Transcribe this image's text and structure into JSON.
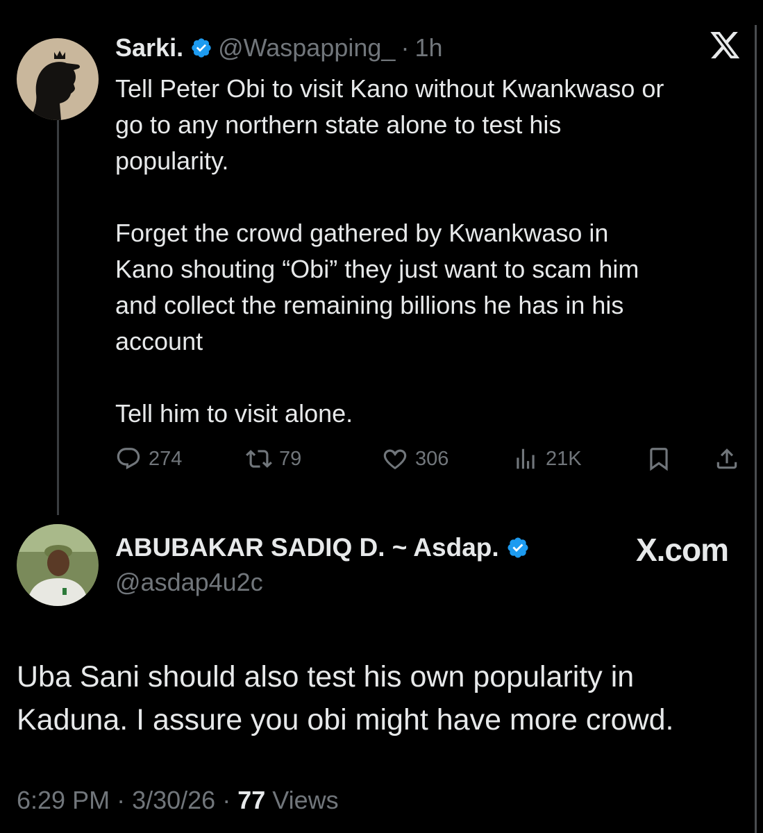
{
  "original_tweet": {
    "author_name": "Sarki.",
    "handle": "@Waspapping_",
    "separator": "·",
    "time_ago": "1h",
    "platform_logo": "X",
    "paragraphs": [
      "Tell Peter Obi to visit Kano without Kwankwaso or\ngo to any northern state alone to test his\npopularity.",
      "Forget the crowd gathered by Kwankwaso in\nKano shouting “Obi” they just want to scam him\nand collect the remaining billions he has in his\naccount",
      "Tell him to visit alone."
    ],
    "actions": {
      "replies": "274",
      "reposts": "79",
      "likes": "306",
      "views": "21K"
    }
  },
  "reply_tweet": {
    "author_name": "ABUBAKAR SADIQ D. ~ Asdap.",
    "handle": "@asdap4u2c",
    "watermark": "X.com",
    "text": "Uba Sani should also test his own popularity in\nKaduna. I assure you obi might have more crowd.",
    "footer": {
      "time": "6:29 PM",
      "sep1": " · ",
      "date": "3/30/26",
      "sep2": " · ",
      "views_count": "77",
      "views_label": "Views"
    }
  },
  "colors": {
    "background": "#000000",
    "text": "#e7e9ea",
    "muted": "#71767b",
    "verified": "#1d9bf0"
  },
  "icons": [
    "verified-badge-icon",
    "x-logo-icon",
    "reply-icon",
    "repost-icon",
    "like-icon",
    "views-icon",
    "bookmark-icon",
    "share-icon"
  ]
}
